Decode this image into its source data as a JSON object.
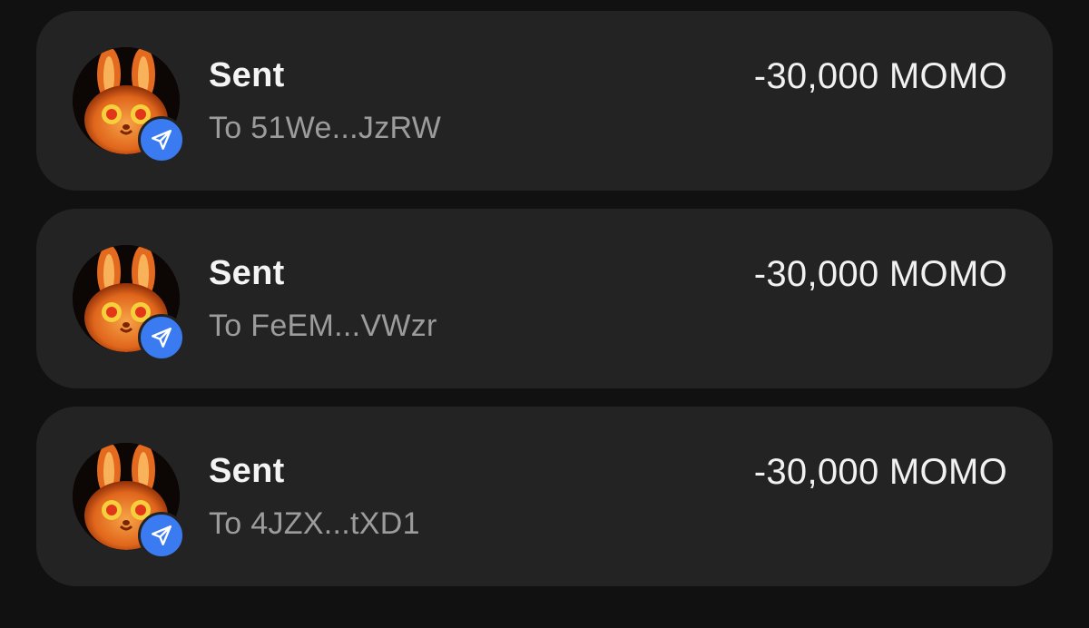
{
  "colors": {
    "background": "#111111",
    "card": "#232323",
    "badge": "#3b7bf2",
    "title_text": "#f4f4f4",
    "subtitle_text": "#9c9c9c",
    "amount_text": "#f1f1f1"
  },
  "transactions": [
    {
      "title": "Sent",
      "subtitle": "To 51We...JzRW",
      "amount": "-30,000 MOMO",
      "avatar_icon": "momo-bunny-avatar",
      "badge_icon": "send-arrow-icon"
    },
    {
      "title": "Sent",
      "subtitle": "To FeEM...VWzr",
      "amount": "-30,000 MOMO",
      "avatar_icon": "momo-bunny-avatar",
      "badge_icon": "send-arrow-icon"
    },
    {
      "title": "Sent",
      "subtitle": "To 4JZX...tXD1",
      "amount": "-30,000 MOMO",
      "avatar_icon": "momo-bunny-avatar",
      "badge_icon": "send-arrow-icon"
    }
  ]
}
